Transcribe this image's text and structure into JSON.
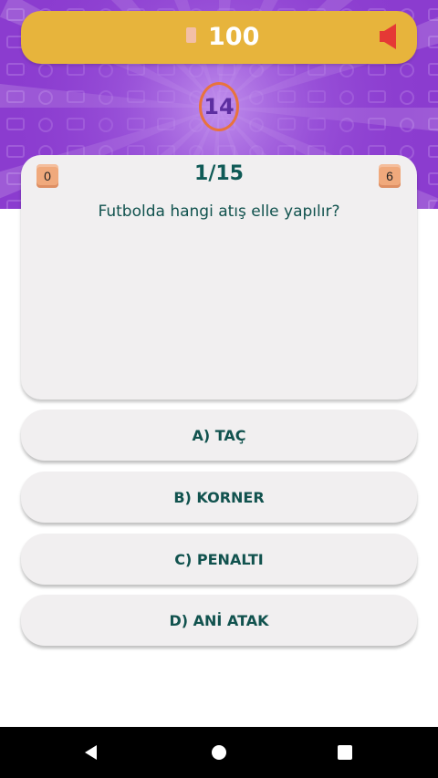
{
  "header": {
    "coins": "100",
    "coin_icon": "coin-icon",
    "sound_icon": "speaker-icon"
  },
  "timer": {
    "seconds": "14"
  },
  "question": {
    "left_badge": "0",
    "right_badge": "6",
    "counter": "1/15",
    "text": "Futbolda hangi atış elle yapılır?"
  },
  "answers": [
    {
      "label": "A) TAÇ"
    },
    {
      "label": "B) KORNER"
    },
    {
      "label": "C) PENALTI"
    },
    {
      "label": "D) ANİ ATAK"
    }
  ],
  "navigation": {
    "back_icon": "back-icon",
    "home_icon": "home-icon",
    "recent_icon": "recent-apps-icon"
  },
  "colors": {
    "hero_purple": "#8a3bd0",
    "top_bar_gold": "#e7b43c",
    "timer_ring": "#e8733d",
    "text_teal": "#11524e",
    "speaker_red": "#e53935"
  }
}
